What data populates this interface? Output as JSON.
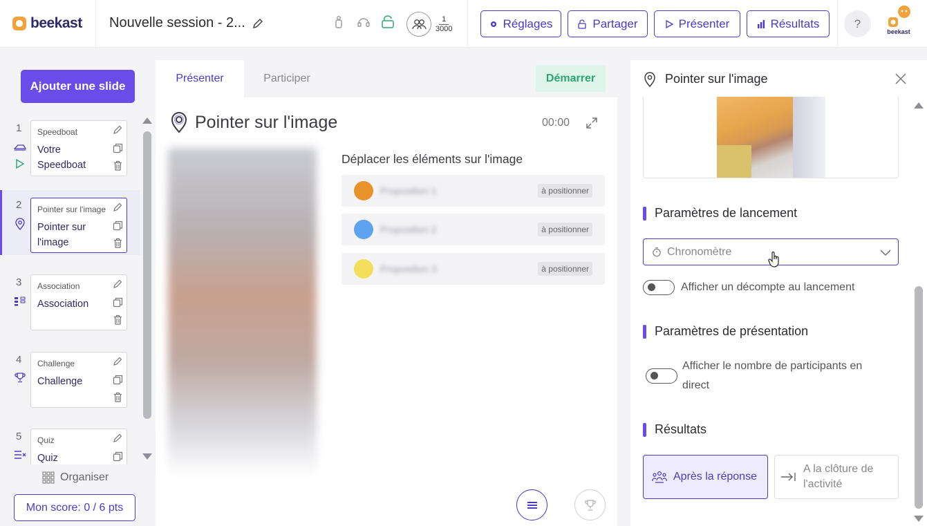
{
  "app": {
    "logo_text": "beekast",
    "session_title": "Nouvelle session - 2...",
    "avatar_text": "beekast"
  },
  "participants": {
    "current": "1",
    "max": "3000"
  },
  "toolbar": {
    "settings_label": "Réglages",
    "share_label": "Partager",
    "present_label": "Présenter",
    "results_label": "Résultats",
    "help_label": "?"
  },
  "sidebar": {
    "add_slide_label": "Ajouter une slide",
    "organise_label": "Organiser",
    "score_label": "Mon score: 0 / 6 pts",
    "slides": [
      {
        "number": "1",
        "kind": "Speedboat",
        "name": "Votre Speedboat",
        "icon": "speedboat-icon"
      },
      {
        "number": "2",
        "kind": "Pointer sur l'image",
        "name": "Pointer sur l'image",
        "icon": "map-pin-icon"
      },
      {
        "number": "3",
        "kind": "Association",
        "name": "Association",
        "icon": "association-icon"
      },
      {
        "number": "4",
        "kind": "Challenge",
        "name": "Challenge",
        "icon": "trophy-icon"
      },
      {
        "number": "5",
        "kind": "Quiz",
        "name": "Quiz",
        "icon": "quiz-icon"
      }
    ]
  },
  "center": {
    "tabs": [
      {
        "label": "Présenter"
      },
      {
        "label": "Participer"
      }
    ],
    "start_label": "Démarrer",
    "title": "Pointer sur l'image",
    "timer": "00:00",
    "instruction": "Déplacer les éléments sur l'image",
    "items": [
      {
        "label": "Proposition 1",
        "badge": "à positionner",
        "color": "#e8932a"
      },
      {
        "label": "Proposition 2",
        "badge": "à positionner",
        "color": "#5ea3ef"
      },
      {
        "label": "Proposition 3",
        "badge": "à positionner",
        "color": "#f4df5c"
      }
    ]
  },
  "panel": {
    "title": "Pointer sur l'image",
    "launch_heading": "Paramètres de lancement",
    "timer_select": "Chronomètre",
    "countdown_label": "Afficher un décompte au lancement",
    "presentation_heading": "Paramètres de présentation",
    "participants_label": "Afficher le nombre de participants en direct",
    "results_heading": "Résultats",
    "after_answer_label": "Après la réponse",
    "on_close_label": "A la clôture de l'activité"
  },
  "colors": {
    "accent": "#4b3bc4",
    "primary_button": "#6a4de8",
    "start_green": "#2aa772",
    "logo_orange": "#f0a23b"
  }
}
